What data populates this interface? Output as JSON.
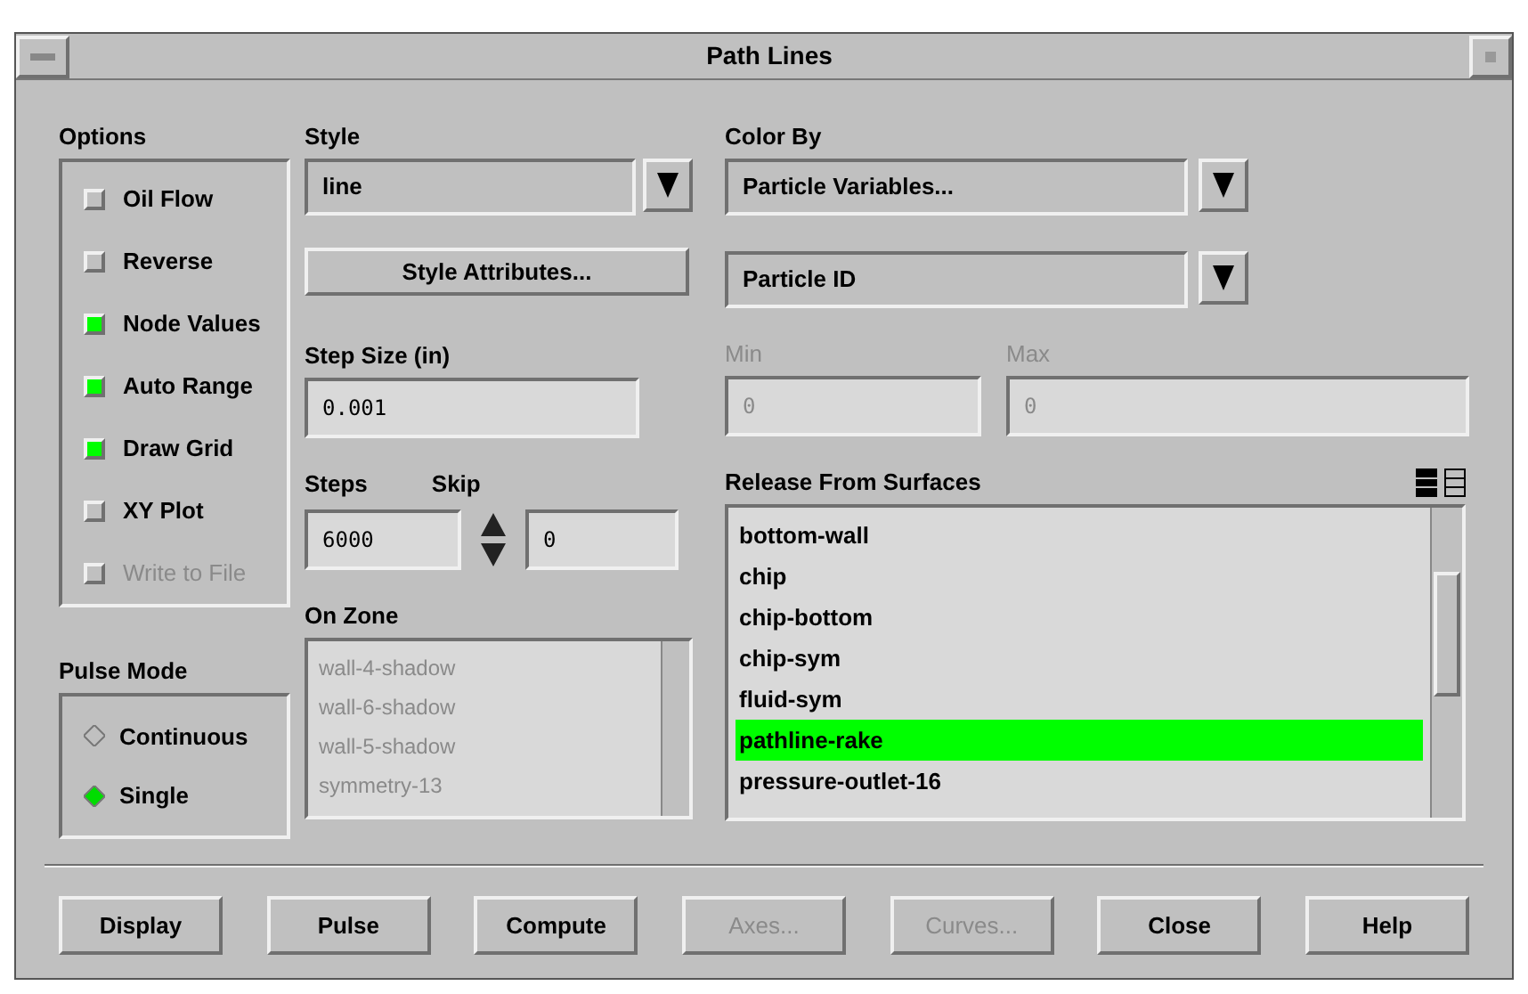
{
  "window": {
    "title": "Path Lines"
  },
  "options": {
    "label": "Options",
    "items": [
      {
        "label": "Oil Flow",
        "checked": false,
        "disabled": false
      },
      {
        "label": "Reverse",
        "checked": false,
        "disabled": false
      },
      {
        "label": "Node Values",
        "checked": true,
        "disabled": false
      },
      {
        "label": "Auto Range",
        "checked": true,
        "disabled": false
      },
      {
        "label": "Draw Grid",
        "checked": true,
        "disabled": false
      },
      {
        "label": "XY Plot",
        "checked": false,
        "disabled": false
      },
      {
        "label": "Write to File",
        "checked": false,
        "disabled": true
      }
    ]
  },
  "pulse_mode": {
    "label": "Pulse Mode",
    "items": [
      {
        "label": "Continuous",
        "selected": false
      },
      {
        "label": "Single",
        "selected": true
      }
    ]
  },
  "style": {
    "label": "Style",
    "value": "line",
    "button": "Style Attributes..."
  },
  "step_size": {
    "label": "Step Size (in)",
    "value": "0.001"
  },
  "steps": {
    "label": "Steps",
    "value": "6000"
  },
  "skip": {
    "label": "Skip",
    "value": "0"
  },
  "on_zone": {
    "label": "On Zone",
    "disabled": true,
    "items": [
      "wall-4-shadow",
      "wall-6-shadow",
      "wall-5-shadow",
      "symmetry-13"
    ]
  },
  "color_by": {
    "label": "Color By",
    "value": "Particle Variables...",
    "sub_value": "Particle ID"
  },
  "min": {
    "label": "Min",
    "value": "0",
    "disabled": true
  },
  "max": {
    "label": "Max",
    "value": "0",
    "disabled": true
  },
  "release_from_surfaces": {
    "label": "Release From Surfaces",
    "items": [
      {
        "label": "bottom-wall",
        "selected": false
      },
      {
        "label": "chip",
        "selected": false
      },
      {
        "label": "chip-bottom",
        "selected": false
      },
      {
        "label": "chip-sym",
        "selected": false
      },
      {
        "label": "fluid-sym",
        "selected": false
      },
      {
        "label": "pathline-rake",
        "selected": true
      },
      {
        "label": "pressure-outlet-16",
        "selected": false
      }
    ]
  },
  "buttons": [
    {
      "label": "Display",
      "disabled": false
    },
    {
      "label": "Pulse",
      "disabled": false
    },
    {
      "label": "Compute",
      "disabled": false
    },
    {
      "label": "Axes...",
      "disabled": true
    },
    {
      "label": "Curves...",
      "disabled": true
    },
    {
      "label": "Close",
      "disabled": false
    },
    {
      "label": "Help",
      "disabled": false
    }
  ]
}
